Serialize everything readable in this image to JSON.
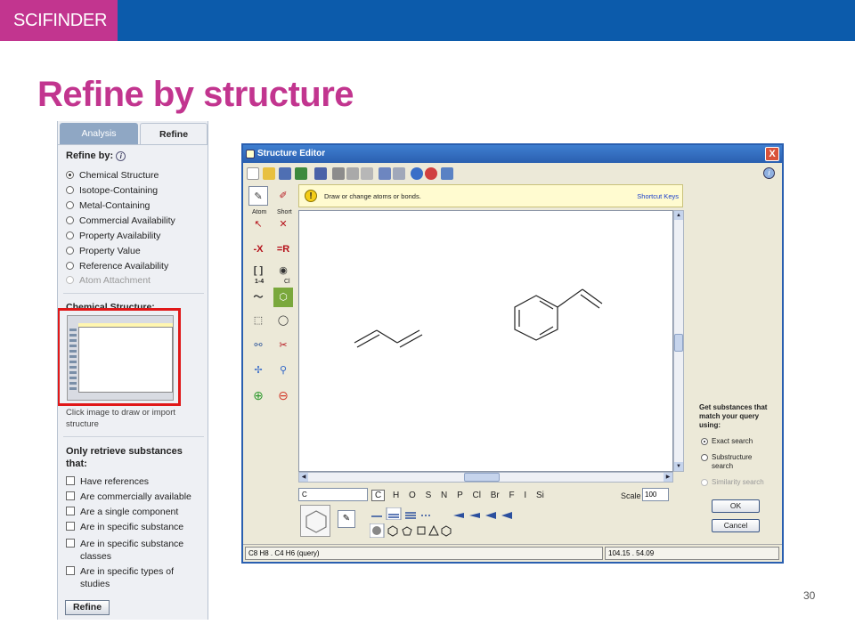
{
  "header": {
    "logo": "SCIFINDER",
    "title": "Refine by structure",
    "page_number": "30"
  },
  "colors": {
    "brand_blue": "#0c5bab",
    "brand_pink": "#c2358f",
    "highlight_red": "#e01818"
  },
  "refine_panel": {
    "tabs": [
      {
        "label": "Analysis",
        "active": false
      },
      {
        "label": "Refine",
        "active": true
      }
    ],
    "refine_by_label": "Refine by:",
    "options": [
      {
        "label": "Chemical Structure",
        "selected": true,
        "disabled": false
      },
      {
        "label": "Isotope-Containing",
        "selected": false,
        "disabled": false
      },
      {
        "label": "Metal-Containing",
        "selected": false,
        "disabled": false
      },
      {
        "label": "Commercial Availability",
        "selected": false,
        "disabled": false
      },
      {
        "label": "Property Availability",
        "selected": false,
        "disabled": false
      },
      {
        "label": "Property Value",
        "selected": false,
        "disabled": false
      },
      {
        "label": "Reference Availability",
        "selected": false,
        "disabled": false
      },
      {
        "label": "Atom Attachment",
        "selected": false,
        "disabled": true
      }
    ],
    "chemical_structure_label": "Chemical Structure:",
    "click_image_text": "Click image to draw or import structure",
    "only_retrieve_label": "Only retrieve substances that:",
    "checkboxes": [
      {
        "label": "Have references",
        "checked": false
      },
      {
        "label": "Are commercially available",
        "checked": false
      },
      {
        "label": "Are a single component",
        "checked": false
      },
      {
        "label": "Are in specific substance",
        "checked": false
      },
      {
        "label": "Are in specific substance classes",
        "checked": false
      },
      {
        "label": "Are in specific types of studies",
        "checked": false
      }
    ],
    "refine_button": "Refine"
  },
  "editor": {
    "title": "Structure Editor",
    "close_label": "X",
    "tip": {
      "text": "Draw or change atoms or bonds.",
      "link": "Shortcut Keys"
    },
    "tool_captions": {
      "atom": "Atom",
      "short": "Short",
      "range": "1-4",
      "chloro": "Cl"
    },
    "formula_input": "C",
    "atoms": [
      "C",
      "H",
      "O",
      "S",
      "N",
      "P",
      "Cl",
      "Br",
      "F",
      "I",
      "Si"
    ],
    "scale_label": "Scale",
    "scale_value": "100",
    "search_panel": {
      "heading": "Get substances that match your query using:",
      "options": [
        {
          "label": "Exact search",
          "selected": true,
          "disabled": false
        },
        {
          "label": "Substructure search",
          "selected": false,
          "disabled": false
        },
        {
          "label": "Similarity search",
          "selected": false,
          "disabled": true
        }
      ],
      "ok_button": "OK",
      "cancel_button": "Cancel"
    },
    "status_left": "C8 H8 . C4 H6 (query)",
    "status_right": "104.15 . 54.09"
  }
}
